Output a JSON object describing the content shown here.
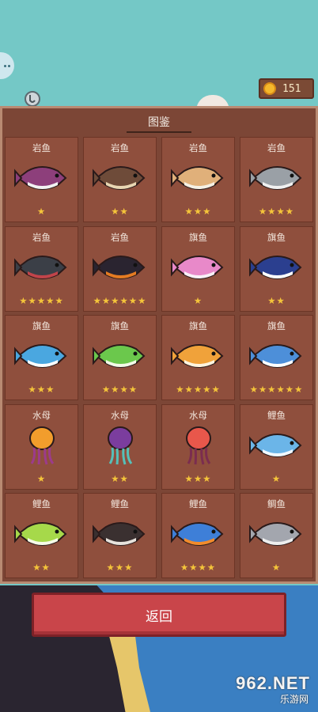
{
  "hud": {
    "coins": "151"
  },
  "panel": {
    "title": "图鉴"
  },
  "cards": [
    {
      "name": "岩鱼",
      "stars": 1,
      "colors": [
        "#8d3f7b",
        "#f2f2f2"
      ]
    },
    {
      "name": "岩鱼",
      "stars": 2,
      "colors": [
        "#6e4b39",
        "#e8d7b3"
      ]
    },
    {
      "name": "岩鱼",
      "stars": 3,
      "colors": [
        "#e0b07a",
        "#f5f0e4"
      ]
    },
    {
      "name": "岩鱼",
      "stars": 4,
      "colors": [
        "#9aa0a6",
        "#f0f0f0"
      ]
    },
    {
      "name": "岩鱼",
      "stars": 5,
      "colors": [
        "#3b3f47",
        "#c1444a"
      ]
    },
    {
      "name": "岩鱼",
      "stars": 6,
      "colors": [
        "#2a2430",
        "#e47b22"
      ]
    },
    {
      "name": "旗鱼",
      "stars": 1,
      "colors": [
        "#e889c9",
        "#f9f0f7"
      ]
    },
    {
      "name": "旗鱼",
      "stars": 2,
      "colors": [
        "#2b3f8f",
        "#ffffff"
      ]
    },
    {
      "name": "旗鱼",
      "stars": 3,
      "colors": [
        "#4aa7e0",
        "#ffffff"
      ]
    },
    {
      "name": "旗鱼",
      "stars": 4,
      "colors": [
        "#6bc84c",
        "#f3fae8"
      ]
    },
    {
      "name": "旗鱼",
      "stars": 5,
      "colors": [
        "#f0a23a",
        "#fff4df"
      ]
    },
    {
      "name": "旗鱼",
      "stars": 6,
      "colors": [
        "#4d8fd9",
        "#ffffff"
      ]
    },
    {
      "name": "水母",
      "stars": 1,
      "colors": [
        "#f29d2c",
        "#9c3b8b"
      ]
    },
    {
      "name": "水母",
      "stars": 2,
      "colors": [
        "#7b3d9e",
        "#56c0b8"
      ]
    },
    {
      "name": "水母",
      "stars": 3,
      "colors": [
        "#e8574b",
        "#7b2d4f"
      ]
    },
    {
      "name": "鲤鱼",
      "stars": 1,
      "colors": [
        "#6bb5e8",
        "#f1f8ff"
      ]
    },
    {
      "name": "鲤鱼",
      "stars": 2,
      "colors": [
        "#a6d94a",
        "#f6fbe8"
      ]
    },
    {
      "name": "鲤鱼",
      "stars": 3,
      "colors": [
        "#3a3030",
        "#e7e2dc"
      ]
    },
    {
      "name": "鲤鱼",
      "stars": 4,
      "colors": [
        "#3e7fd8",
        "#f28b2c"
      ]
    },
    {
      "name": "鲷鱼",
      "stars": 1,
      "colors": [
        "#a3a6ae",
        "#eeeeee"
      ]
    }
  ],
  "back_button": {
    "label": "返回"
  },
  "watermark": {
    "number": "962.NET",
    "site": "乐游网"
  }
}
